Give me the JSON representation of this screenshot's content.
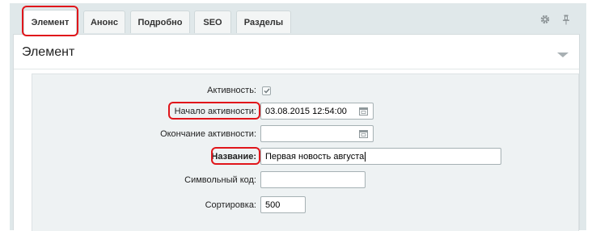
{
  "tabs": [
    {
      "label": "Элемент"
    },
    {
      "label": "Анонс"
    },
    {
      "label": "Подробно"
    },
    {
      "label": "SEO"
    },
    {
      "label": "Разделы"
    }
  ],
  "panel": {
    "title": "Элемент"
  },
  "fields": {
    "active": {
      "label": "Активность:",
      "checked": true
    },
    "active_from": {
      "label": "Начало активности:",
      "value": "03.08.2015 12:54:00"
    },
    "active_to": {
      "label": "Окончание активности:",
      "value": ""
    },
    "name": {
      "label": "Название:",
      "value": "Первая новость августа"
    },
    "code": {
      "label": "Символьный код:",
      "value": ""
    },
    "sort": {
      "label": "Сортировка:",
      "value": "500"
    }
  },
  "colors": {
    "highlight": "#e0161b",
    "background": "#e0e8ea"
  }
}
